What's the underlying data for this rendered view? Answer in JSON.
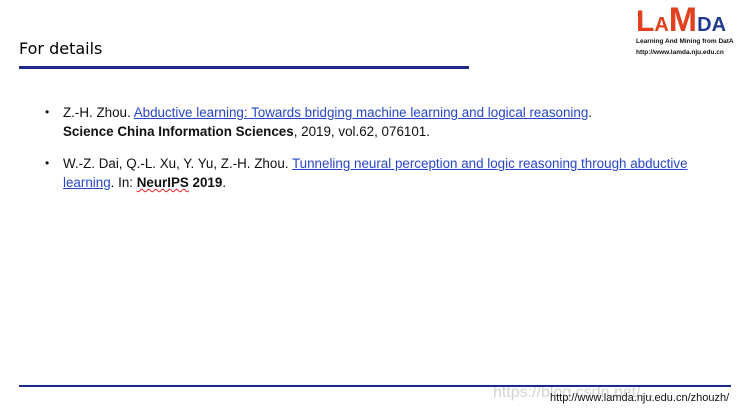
{
  "slide": {
    "title": "For details",
    "logo": {
      "letters": [
        "L",
        "A",
        "M",
        "D",
        "A"
      ],
      "tagline": "Learning And Mining from DatA",
      "url": "http://www.lamda.nju.edu.cn"
    },
    "references": [
      {
        "authors": "Z.-H. Zhou. ",
        "title_link": "Abductive learning: Towards bridging machine learning and logical reasoning",
        "after_title": ".",
        "venue": "Science China Information Sciences",
        "details": ", 2019, vol.62, 076101."
      },
      {
        "authors": "W.-Z. Dai, Q.-L. Xu, Y. Yu, Z.-H. Zhou. ",
        "title_link": "Tunneling neural perception and logic reasoning through abductive learning",
        "after_title": ". In: ",
        "venue_prefix": "NeurIPS",
        "venue_suffix": " 2019",
        "details": "."
      }
    ],
    "footer_url": "http://www.lamda.nju.edu.cn/zhouzh/",
    "watermark": "https://blog.csdn.net/..."
  },
  "colors": {
    "accent_rule": "#1f2a86",
    "link": "#2746c9",
    "logo_red": "#e2401f",
    "logo_blue": "#1f3b8f"
  }
}
